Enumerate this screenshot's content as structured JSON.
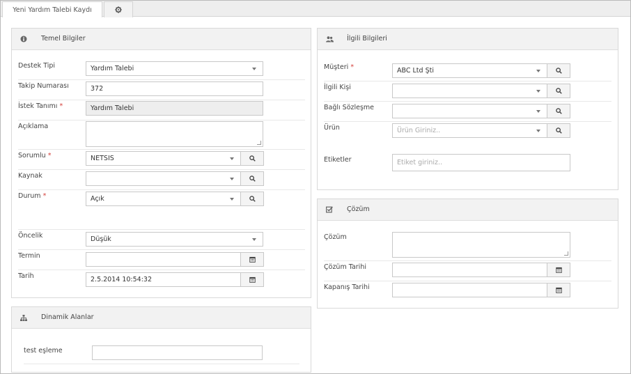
{
  "tabs": [
    {
      "label": "Yeni Yardım Talebi Kaydı"
    },
    {
      "icon": "gear-icon"
    }
  ],
  "temel": {
    "title": "Temel Bilgiler",
    "icon": "info-circle-icon",
    "destek_tipi": {
      "label": "Destek Tipi",
      "value": "Yardım Talebi"
    },
    "takip": {
      "label": "Takip Numarası",
      "value": "372"
    },
    "istek": {
      "label": "İstek Tanımı",
      "required": "*",
      "value": "Yardım Talebi"
    },
    "aciklama": {
      "label": "Açıklama",
      "value": ""
    },
    "sorumlu": {
      "label": "Sorumlu",
      "required": "*",
      "value": "NETSIS"
    },
    "kaynak": {
      "label": "Kaynak",
      "value": ""
    },
    "durum": {
      "label": "Durum",
      "required": "*",
      "value": "Açık"
    },
    "oncelik": {
      "label": "Öncelik",
      "value": "Düşük"
    },
    "termin": {
      "label": "Termin",
      "value": ""
    },
    "tarih": {
      "label": "Tarih",
      "value": "2.5.2014 10:54:32"
    }
  },
  "dinamik": {
    "title": "Dinamik Alanlar",
    "icon": "sitemap-icon",
    "test": {
      "label": "test eşleme",
      "value": ""
    }
  },
  "ilgili": {
    "title": "İlgili Bilgileri",
    "icon": "users-icon",
    "musteri": {
      "label": "Müşteri",
      "required": "*",
      "value": "ABC Ltd Şti"
    },
    "kisi": {
      "label": "İlgili Kişi",
      "value": ""
    },
    "sozlesme": {
      "label": "Bağlı Sözleşme",
      "value": ""
    },
    "urun": {
      "label": "Ürün",
      "placeholder": "Ürün Giriniz.."
    },
    "etiket": {
      "label": "Etiketler",
      "placeholder": "Etiket giriniz.."
    }
  },
  "cozum": {
    "title": "Çözüm",
    "icon": "check-square-icon",
    "cozum": {
      "label": "Çözüm",
      "value": ""
    },
    "cozum_tarihi": {
      "label": "Çözüm Tarihi",
      "value": ""
    },
    "kapanis_tarihi": {
      "label": "Kapanış Tarihi",
      "value": ""
    }
  },
  "colors": {
    "accent_required": "#d43f3a",
    "header_bg": "#f2f2f2",
    "readonly_bg": "#eeeeee"
  }
}
